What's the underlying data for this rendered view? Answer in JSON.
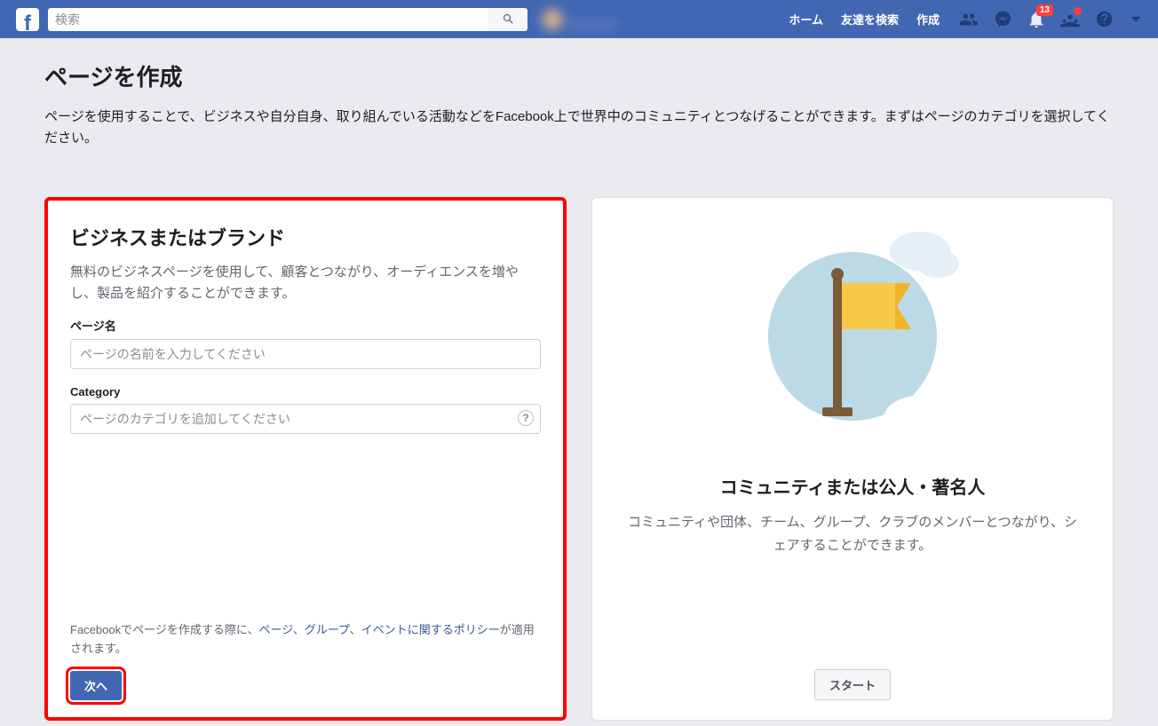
{
  "nav": {
    "search_placeholder": "検索",
    "profile_name": "＿＿＿＿",
    "links": {
      "home": "ホーム",
      "find_friends": "友達を検索",
      "create": "作成"
    },
    "badge_count": "13"
  },
  "header": {
    "title": "ページを作成",
    "subtitle": "ページを使用することで、ビジネスや自分自身、取り組んでいる活動などをFacebook上で世界中のコミュニティとつなげることができます。まずはページのカテゴリを選択してください。"
  },
  "left": {
    "title": "ビジネスまたはブランド",
    "desc": "無料のビジネスページを使用して、顧客とつながり、オーディエンスを増やし、製品を紹介することができます。",
    "page_name_label": "ページ名",
    "page_name_placeholder": "ページの名前を入力してください",
    "category_label": "Category",
    "category_placeholder": "ページのカテゴリを追加してください",
    "legal_prefix": "Facebookでページを作成する際に、",
    "legal_link1": "ページ",
    "legal_sep1": "、",
    "legal_link2": "グループ",
    "legal_sep2": "、",
    "legal_link3": "イベントに関するポリシー",
    "legal_suffix": "が適用されます。",
    "next": "次へ"
  },
  "right": {
    "title": "コミュニティまたは公人・著名人",
    "desc": "コミュニティや団体、チーム、グループ、クラブのメンバーとつながり、シェアすることができます。",
    "start": "スタート"
  }
}
